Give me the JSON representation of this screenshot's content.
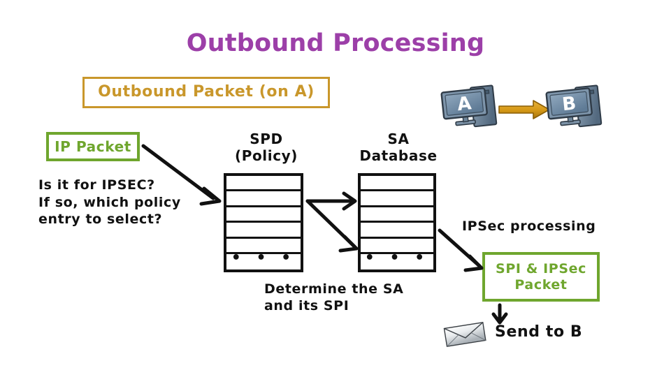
{
  "slide": {
    "title": "Outbound Processing",
    "title_color": "#9C3FA8",
    "background": "#ffffff"
  },
  "palette": {
    "gold": "#C9972B",
    "green": "#6FA62E",
    "ink": "#111111",
    "purple": "#9C3FA8",
    "arrow_orange": "#D79A18"
  },
  "diagram": {
    "outbound_packet_label": "Outbound Packet (on A)",
    "ip_packet_label": "IP Packet",
    "question_text": "Is it for IPSEC?\nIf so, which policy\nentry to select?",
    "spd_caption": "SPD\n(Policy)",
    "sa_caption": "SA\nDatabase",
    "determine_text": "Determine the SA\nand its SPI",
    "ipsec_processing_label": "IPSec processing",
    "spi_packet_line1": "SPI & IPSec",
    "spi_packet_line2": "Packet",
    "send_to_b_label": "Send to B",
    "dots": "•  •  •",
    "spd_table": {
      "rows": [
        "",
        "",
        "",
        "",
        "",
        "dots"
      ],
      "row_count": 6
    },
    "sa_table": {
      "rows": [
        "",
        "",
        "",
        "",
        "",
        "dots"
      ],
      "row_count": 6
    },
    "hosts": [
      {
        "name": "A",
        "label": "A"
      },
      {
        "name": "B",
        "label": "B"
      }
    ],
    "arrows": [
      {
        "name": "ip-packet-to-spd",
        "from": "IP Packet",
        "to": "SPD (Policy)"
      },
      {
        "name": "spd-to-sa-top",
        "from": "SPD (Policy)",
        "to": "SA Database"
      },
      {
        "name": "spd-to-sa-diagonal",
        "from": "SPD (Policy)",
        "to": "SA Database"
      },
      {
        "name": "sa-to-spi-packet",
        "from": "SA Database",
        "to": "SPI & IPSec Packet"
      },
      {
        "name": "spi-packet-to-send",
        "from": "SPI & IPSec Packet",
        "to": "Send to B"
      },
      {
        "name": "host-a-to-host-b",
        "from": "A",
        "to": "B"
      }
    ]
  }
}
